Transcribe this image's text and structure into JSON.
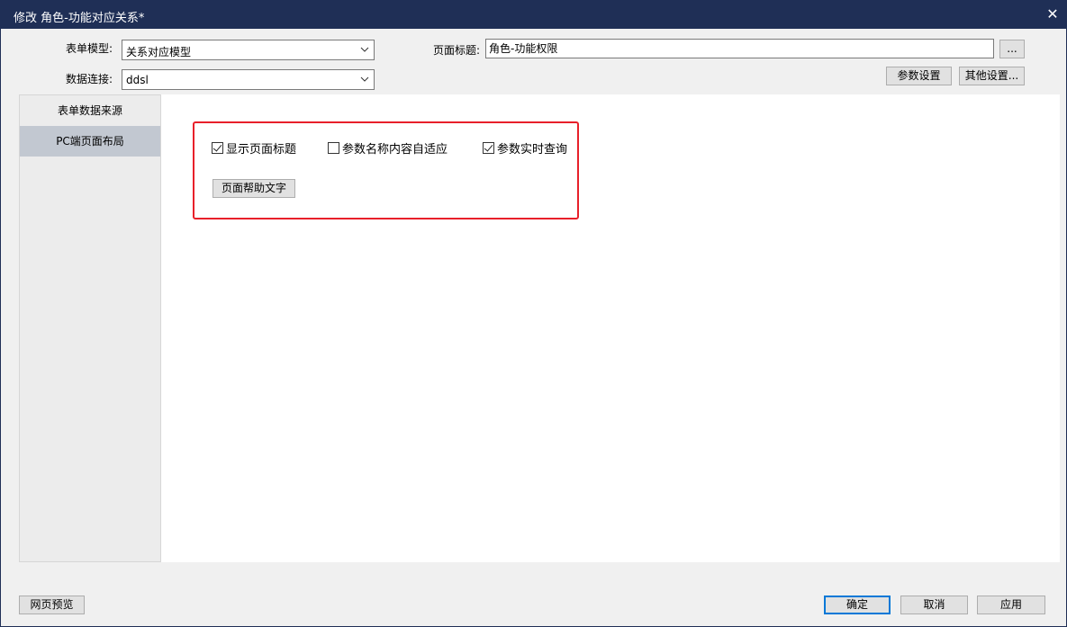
{
  "window": {
    "title": "修改 角色-功能对应关系*",
    "close_symbol": "✕"
  },
  "form": {
    "model_label": "表单模型:",
    "model_value": "关系对应模型",
    "connection_label": "数据连接:",
    "connection_value": "ddsl",
    "page_title_label": "页面标题:",
    "page_title_value": "角色-功能权限",
    "ellipsis_label": "...",
    "param_settings_label": "参数设置",
    "other_settings_label": "其他设置..."
  },
  "sidebar": {
    "items": [
      {
        "label": "表单数据来源",
        "active": false
      },
      {
        "label": "PC端页面布局",
        "active": true
      }
    ]
  },
  "options": {
    "show_title": {
      "label": "显示页面标题",
      "checked": true
    },
    "param_autofit": {
      "label": "参数名称内容自适应",
      "checked": false
    },
    "realtime_query": {
      "label": "参数实时查询",
      "checked": true
    },
    "help_text_button": "页面帮助文字"
  },
  "footer": {
    "preview_label": "网页预览",
    "ok_label": "确定",
    "cancel_label": "取消",
    "apply_label": "应用"
  },
  "colors": {
    "titlebar": "#1f2f56",
    "highlight": "#e8202a",
    "sidebar_active": "#c2c8d1"
  }
}
